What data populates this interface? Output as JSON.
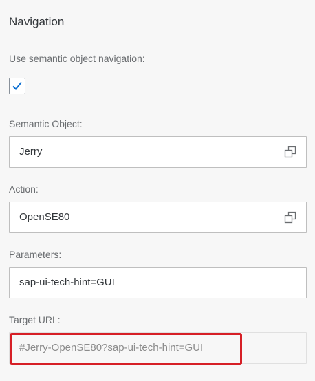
{
  "section": {
    "title": "Navigation"
  },
  "semantic_nav": {
    "label": "Use semantic object navigation:",
    "checked": true
  },
  "semantic_object": {
    "label": "Semantic Object:",
    "value": "Jerry",
    "icon": "value-help-icon"
  },
  "action": {
    "label": "Action:",
    "value": "OpenSE80",
    "icon": "value-help-icon"
  },
  "parameters": {
    "label": "Parameters:",
    "value": "sap-ui-tech-hint=GUI"
  },
  "target_url": {
    "label": "Target URL:",
    "value": "#Jerry-OpenSE80?sap-ui-tech-hint=GUI"
  },
  "colors": {
    "accent": "#0a6ed1",
    "highlight": "#d61f26"
  }
}
